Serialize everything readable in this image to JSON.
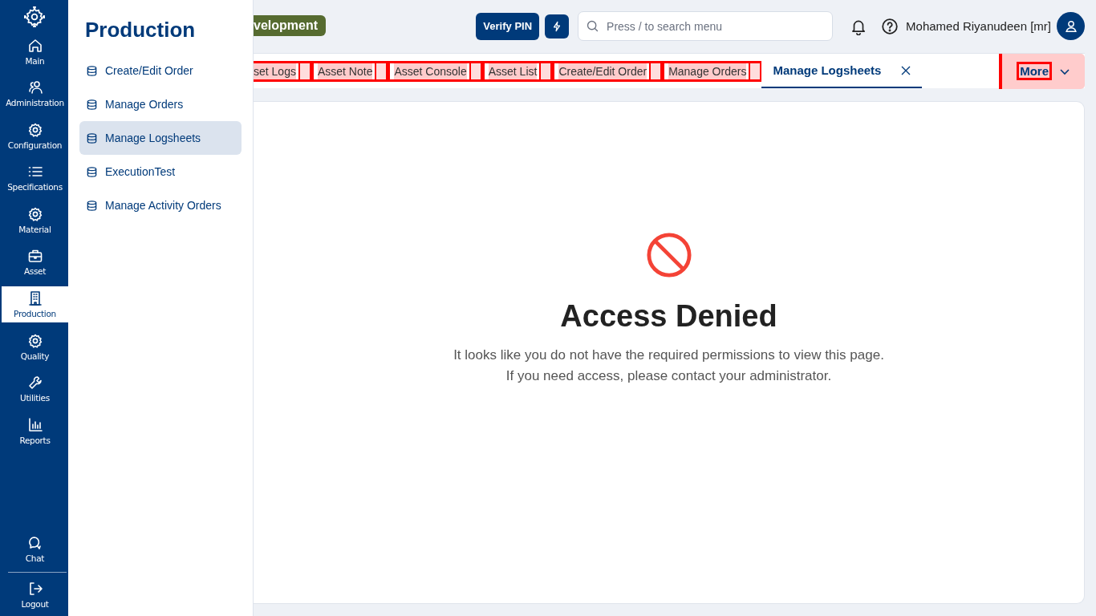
{
  "rail": {
    "items": [
      {
        "label": "Main",
        "selected": false
      },
      {
        "label": "Administration",
        "selected": false
      },
      {
        "label": "Configuration",
        "selected": false
      },
      {
        "label": "Specifications",
        "selected": false
      },
      {
        "label": "Material",
        "selected": false
      },
      {
        "label": "Asset",
        "selected": false
      },
      {
        "label": "Production",
        "selected": true
      },
      {
        "label": "Quality",
        "selected": false
      },
      {
        "label": "Utilities",
        "selected": false
      },
      {
        "label": "Reports",
        "selected": false
      }
    ],
    "bottom": [
      {
        "label": "Chat"
      },
      {
        "label": "Logout"
      }
    ]
  },
  "flyout": {
    "title": "Production",
    "items": [
      {
        "label": "Create/Edit Order",
        "selected": false
      },
      {
        "label": "Manage Orders",
        "selected": false
      },
      {
        "label": "Manage Logsheets",
        "selected": true
      },
      {
        "label": "ExecutionTest",
        "selected": false
      },
      {
        "label": "Manage Activity Orders",
        "selected": false
      }
    ]
  },
  "header": {
    "environment": "velopment",
    "verify_pin": "Verify PIN",
    "search": {
      "placeholder": "Press / to search menu"
    },
    "user": "Mohamed Riyanudeen [mr]"
  },
  "tabs": [
    {
      "label": "set Logs",
      "selected": false
    },
    {
      "label": "Asset Note",
      "selected": false
    },
    {
      "label": "Asset Console",
      "selected": false
    },
    {
      "label": "Asset List",
      "selected": false
    },
    {
      "label": "Create/Edit Order",
      "selected": false
    },
    {
      "label": "Manage Orders",
      "selected": false
    },
    {
      "label": "Manage Logsheets",
      "selected": true
    }
  ],
  "more": "More",
  "content": {
    "title": "Access Denied",
    "lines": [
      "It looks like you do not have the required permissions to view this page.",
      "If you need access, please contact your administrator."
    ]
  }
}
